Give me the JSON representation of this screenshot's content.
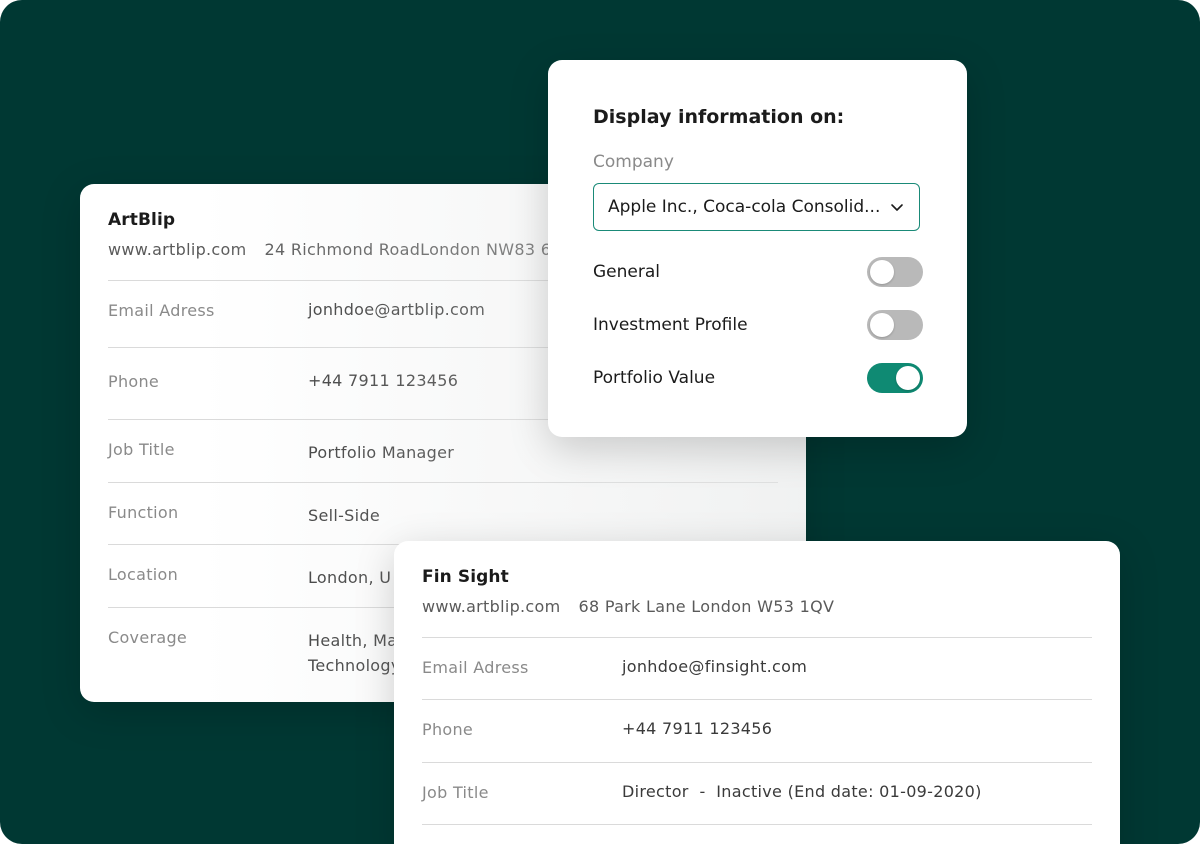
{
  "card_artblip": {
    "name": "ArtBlip",
    "website": "www.artblip.com",
    "address": "24 Richmond RoadLondon NW83 6",
    "rows": [
      {
        "label": "Email Adress",
        "value": "jonhdoe@artblip.com"
      },
      {
        "label": "Phone",
        "value": "+44 7911 123456"
      },
      {
        "label": "Job Title",
        "value": "Portfolio Manager"
      },
      {
        "label": "Function",
        "value": "Sell-Side"
      },
      {
        "label": "Location",
        "value": "London, U"
      },
      {
        "label": "Coverage",
        "value": "Health, Ma",
        "value2": "Technology"
      }
    ]
  },
  "card_finsight": {
    "name": "Fin Sight",
    "website": "www.artblip.com",
    "address": "68 Park Lane London W53 1QV",
    "rows": [
      {
        "label": "Email Adress",
        "value": "jonhdoe@finsight.com"
      },
      {
        "label": "Phone",
        "value": "+44 7911 123456"
      },
      {
        "label": "Job Title",
        "value": "Director  -  Inactive (End date: 01-09-2020)"
      }
    ]
  },
  "popover": {
    "title": "Display information on:",
    "company_label": "Company",
    "company_value": "Apple Inc., Coca-cola Consolid...",
    "options": [
      {
        "label": "General",
        "enabled": false
      },
      {
        "label": "Investment Profile",
        "enabled": false
      },
      {
        "label": "Portfolio Value",
        "enabled": true
      }
    ]
  },
  "colors": {
    "background": "#003833",
    "accent": "#0f8a73",
    "toggle_off": "#b9b9b9"
  }
}
